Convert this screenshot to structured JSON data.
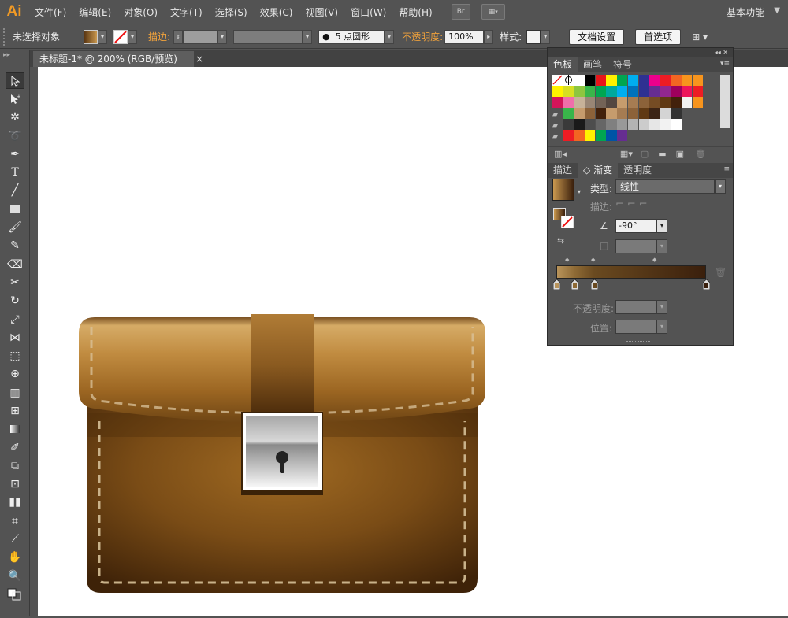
{
  "app": {
    "logo": "Ai"
  },
  "menu": [
    "文件(F)",
    "编辑(E)",
    "对象(O)",
    "文字(T)",
    "选择(S)",
    "效果(C)",
    "视图(V)",
    "窗口(W)",
    "帮助(H)"
  ],
  "menubar_buttons": {
    "bridge": "Br",
    "arrange": "▦"
  },
  "workspace": {
    "label": "基本功能",
    "arrow": "▼"
  },
  "control_bar": {
    "selection_status": "未选择对象",
    "stroke_label": "描边:",
    "brush_size": "5",
    "brush_shape": "点圆形",
    "opacity_label": "不透明度:",
    "opacity_value": "100%",
    "style_label": "样式:",
    "doc_setup_button": "文档设置",
    "preferences_button": "首选项"
  },
  "document_tab": {
    "title": "未标题-1* @ 200% (RGB/预览)",
    "close": "×"
  },
  "panel": {
    "top_controls": "◂◂ ✕",
    "swatch_tabs": [
      "色板",
      "画笔",
      "符号"
    ],
    "gradient_tabs": [
      "描边",
      "渐变",
      "透明度"
    ],
    "type_label": "类型:",
    "type_value": "线性",
    "stroke_label": "描边:",
    "angle_value": "-90°",
    "opacity_label": "不透明度:",
    "position_label": "位置:",
    "gradient_colors": [
      "#b8935a",
      "#8e6a35",
      "#6a4a20",
      "#3a1f0c"
    ],
    "gradient_stops": [
      0.0,
      0.12,
      0.25,
      1.0
    ]
  },
  "swatch_rows": [
    [
      "#ffffff",
      "#ffffff",
      "#ffffff",
      "#000000",
      "#e8151b",
      "#fff100",
      "#00a651",
      "#00aeef",
      "#2e3192",
      "#ec008c",
      "#ed1c24",
      "#f26522",
      "#f7941d",
      "#f7941d"
    ],
    [
      "#fff200",
      "#d7df23",
      "#8dc63f",
      "#39b54a",
      "#00a651",
      "#00a99d",
      "#00aeef",
      "#0072bc",
      "#2e3192",
      "#662d91",
      "#92278f",
      "#9e005d",
      "#ed145b",
      "#ed1c24"
    ],
    [
      "#d4145a",
      "#f06eaa",
      "#c7b299",
      "#998675",
      "#736357",
      "#534741",
      "#c69c6d",
      "#a67c52",
      "#8c6239",
      "#754c24",
      "#603913",
      "#42210b",
      "#f1f1f1",
      "#f7941d"
    ],
    [
      "#ffffff",
      "#39b54a",
      "#c69c6d",
      "#8c6239",
      "#42210b",
      "#c69c6d",
      "#a67c52",
      "#8c6239",
      "#603913",
      "#3c2415",
      "#d4d4d4",
      "#333333"
    ],
    [
      "#ffffff",
      "#3a3a3a",
      "#1a1a1a",
      "#4d4d4d",
      "#666666",
      "#808080",
      "#999999",
      "#b3b3b3",
      "#cccccc",
      "#e6e6e6",
      "#f2f2f2",
      "#ffffff"
    ],
    [
      "#ffffff",
      "#ed1c24",
      "#f26522",
      "#fff200",
      "#00a651",
      "#0054a6",
      "#662d91"
    ]
  ],
  "artwork": {
    "bag_colors": {
      "flap_light": "#c9984f",
      "flap_mid": "#a8742b",
      "flap_dark": "#6e4514",
      "body_light": "#8a5a1c",
      "body_dark": "#3e2208",
      "strap": "#7a4a16",
      "stitch": "#c9b28a"
    },
    "lock_colors": {
      "plate_top": "#bdbdbd",
      "plate_bottom": "#f5f5f5",
      "keyhole": "#222222"
    }
  }
}
